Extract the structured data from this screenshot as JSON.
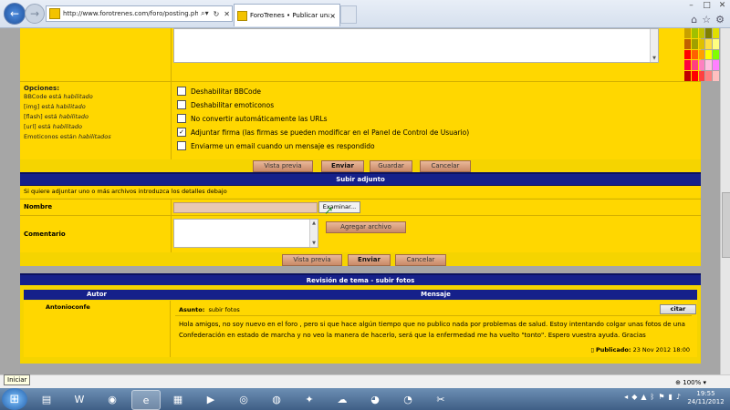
{
  "browser": {
    "url": "http://www.forotrenes.com/foro/posting.php?mo",
    "tab_title": "ForoTrenes • Publicar una r...",
    "close_tab": "×",
    "back": "←",
    "forward": "→"
  },
  "options": {
    "heading": "Opciones:",
    "left_lines": [
      {
        "pre": "BBCode está ",
        "em": "habilitado"
      },
      {
        "pre": "[img] está ",
        "em": "habilitado"
      },
      {
        "pre": "[flash] está ",
        "em": "habilitado"
      },
      {
        "pre": "[url] está ",
        "em": "habilitado"
      },
      {
        "pre": "Emoticonos están ",
        "em": "habilitados"
      }
    ],
    "checkboxes": [
      {
        "label": "Deshabilitar BBCode",
        "checked": false
      },
      {
        "label": "Deshabilitar emoticonos",
        "checked": false
      },
      {
        "label": "No convertir automáticamente las URLs",
        "checked": false
      },
      {
        "label": "Adjuntar firma (las firmas se pueden modificar en el Panel de Control de Usuario)",
        "checked": true
      },
      {
        "label": "Enviarme un email cuando un mensaje es respondido",
        "checked": false
      }
    ]
  },
  "buttons1": {
    "preview": "Vista previa",
    "send": "Enviar",
    "save": "Guardar",
    "cancel": "Cancelar"
  },
  "attach": {
    "title": "Subir adjunto",
    "intro": "Si quiere adjuntar uno o más archivos introduzca los detalles debajo",
    "name_label": "Nombre",
    "browse": "Examinar...",
    "comment_label": "Comentario",
    "add_file": "Agregar archivo"
  },
  "buttons2": {
    "preview": "Vista previa",
    "send": "Enviar",
    "cancel": "Cancelar"
  },
  "review": {
    "title": "Revisión de tema - subir fotos",
    "col_author": "Autor",
    "col_message": "Mensaje",
    "author": "Antonioconfe",
    "subject_label": "Asunto:",
    "subject": "subir fotos",
    "quote_btn": "citar",
    "body_line1": "Hola amigos, no soy nuevo en el foro , pero si que hace algún tiempo que no publico nada por problemas de salud. Estoy intentando colgar unas fotos de una",
    "body_line2": "Confederación en estado de marcha y no veo la manera de hacerlo, será que la enfermedad me ha vuelto \"tonto\". Espero vuestra ayuda. Gracias",
    "posted_label": "Publicado:",
    "posted_date": "23 Nov 2012 18:00"
  },
  "statusbar": {
    "tooltip": "Iniciar",
    "zoom": "100%"
  },
  "taskbar": {
    "time": "19:55",
    "date": "24/11/2012"
  }
}
